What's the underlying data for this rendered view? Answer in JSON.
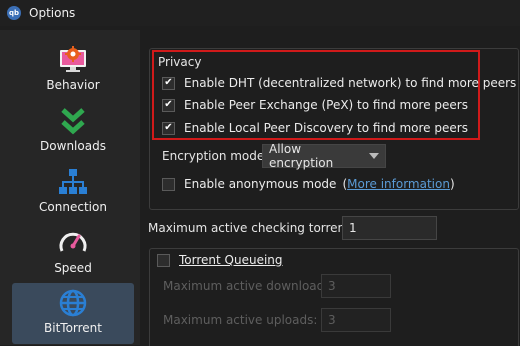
{
  "window": {
    "title": "Options",
    "app_icon_text": "qb"
  },
  "sidebar": {
    "items": [
      {
        "label": "Behavior",
        "icon": "monitor-gear-icon",
        "selected": false
      },
      {
        "label": "Downloads",
        "icon": "double-chevron-down-icon",
        "selected": false
      },
      {
        "label": "Connection",
        "icon": "network-icon",
        "selected": false
      },
      {
        "label": "Speed",
        "icon": "speedometer-icon",
        "selected": false
      },
      {
        "label": "BitTorrent",
        "icon": "globe-icon",
        "selected": true
      }
    ]
  },
  "privacy": {
    "title": "Privacy",
    "dht_label": "Enable DHT (decentralized network) to find more peers",
    "dht_checked": true,
    "pex_label": "Enable Peer Exchange (PeX) to find more peers",
    "pex_checked": true,
    "lpd_label": "Enable Local Peer Discovery to find more peers",
    "lpd_checked": true,
    "encryption_label": "Encryption mode:",
    "encryption_value": "Allow encryption",
    "anonymous_label": "Enable anonymous mode",
    "anonymous_checked": false,
    "more_info_open": "(",
    "more_info_link": "More information",
    "more_info_close": ")"
  },
  "checking": {
    "label": "Maximum active checking torrents:",
    "value": "1"
  },
  "queueing": {
    "title": "Torrent Queueing",
    "checked": false,
    "max_downloads_label": "Maximum active downloads:",
    "max_downloads_value": "3",
    "max_uploads_label": "Maximum active uploads:",
    "max_uploads_value": "3"
  },
  "colors": {
    "highlight": "#d11a1a",
    "accent": "#3a4a5c",
    "link": "#5b9bd5"
  }
}
